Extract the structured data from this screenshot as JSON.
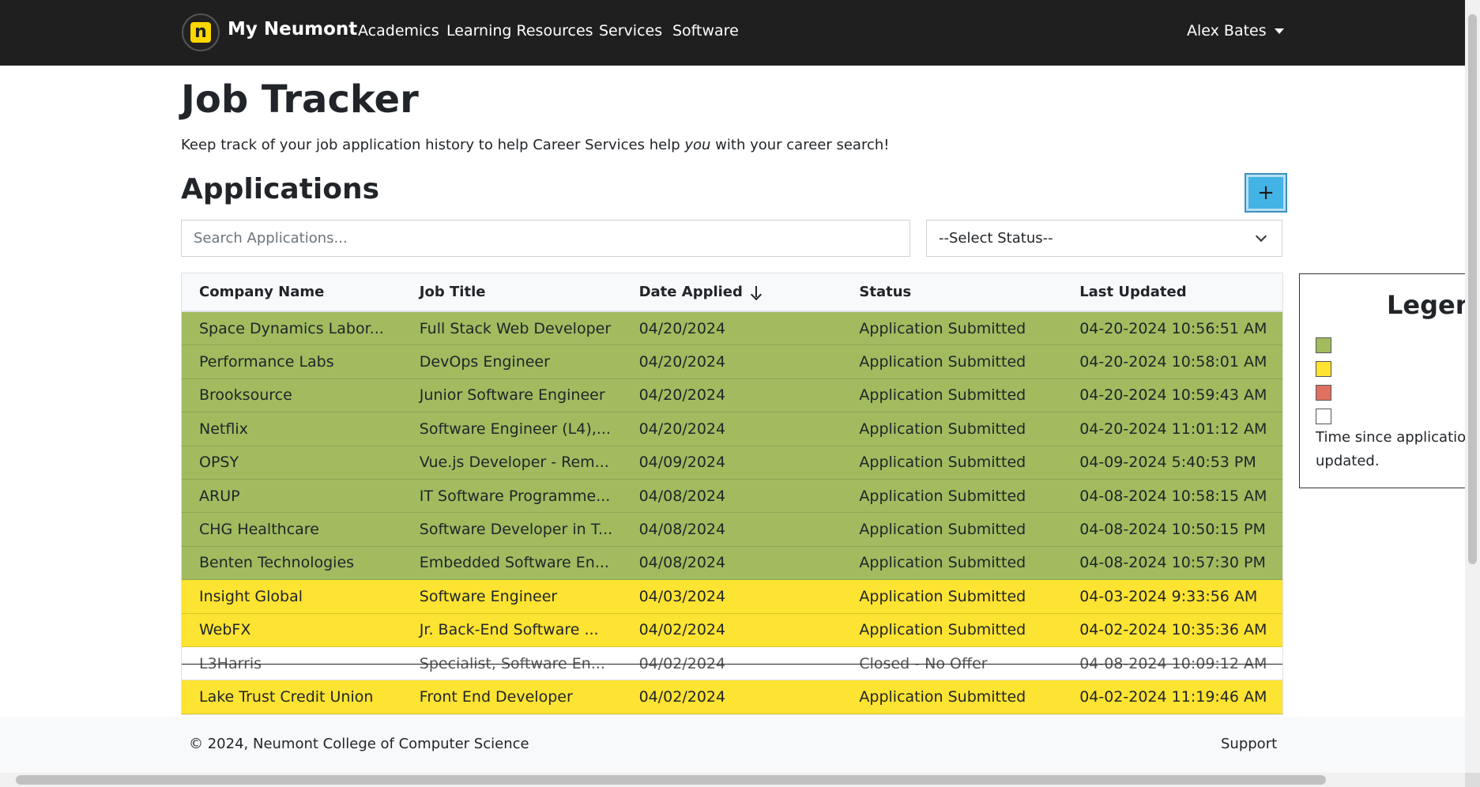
{
  "navbar": {
    "logo_letter": "n",
    "brand": "My Neumont",
    "links": [
      "Academics",
      "Learning Resources",
      "Services",
      "Software"
    ],
    "user": "Alex Bates"
  },
  "page": {
    "title": "Job Tracker",
    "intro_before": "Keep track of your job application history to help Career Services help ",
    "intro_em": "you",
    "intro_after": " with your career search!",
    "section_title": "Applications",
    "add_label": "+"
  },
  "filters": {
    "search_placeholder": "Search Applications...",
    "status_selected": "--Select Status--"
  },
  "table": {
    "headers": [
      "Company Name",
      "Job Title",
      "Date Applied",
      "Status",
      "Last Updated"
    ],
    "sorted_column": "Date Applied",
    "sort_direction": "descending",
    "rows": [
      {
        "company": "Space Dynamics Labor...",
        "title": "Full Stack Web Developer",
        "date": "04/20/2024",
        "status": "Application Submitted",
        "updated": "04-20-2024 10:56:51 AM",
        "color": "green"
      },
      {
        "company": "Performance Labs",
        "title": "DevOps Engineer",
        "date": "04/20/2024",
        "status": "Application Submitted",
        "updated": "04-20-2024 10:58:01 AM",
        "color": "green"
      },
      {
        "company": "Brooksource",
        "title": "Junior Software Engineer",
        "date": "04/20/2024",
        "status": "Application Submitted",
        "updated": "04-20-2024 10:59:43 AM",
        "color": "green"
      },
      {
        "company": "Netflix",
        "title": "Software Engineer (L4),...",
        "date": "04/20/2024",
        "status": "Application Submitted",
        "updated": "04-20-2024 11:01:12 AM",
        "color": "green"
      },
      {
        "company": "OPSY",
        "title": "Vue.js Developer - Rem...",
        "date": "04/09/2024",
        "status": "Application Submitted",
        "updated": "04-09-2024 5:40:53 PM",
        "color": "green"
      },
      {
        "company": "ARUP",
        "title": "IT Software Programme...",
        "date": "04/08/2024",
        "status": "Application Submitted",
        "updated": "04-08-2024 10:58:15 AM",
        "color": "green"
      },
      {
        "company": "CHG Healthcare",
        "title": "Software Developer in T...",
        "date": "04/08/2024",
        "status": "Application Submitted",
        "updated": "04-08-2024 10:50:15 PM",
        "color": "green"
      },
      {
        "company": "Benten Technologies",
        "title": "Embedded Software En...",
        "date": "04/08/2024",
        "status": "Application Submitted",
        "updated": "04-08-2024 10:57:30 PM",
        "color": "green"
      },
      {
        "company": "Insight Global",
        "title": "Software Engineer",
        "date": "04/03/2024",
        "status": "Application Submitted",
        "updated": "04-03-2024 9:33:56 AM",
        "color": "yellow"
      },
      {
        "company": "WebFX",
        "title": "Jr. Back-End Software ...",
        "date": "04/02/2024",
        "status": "Application Submitted",
        "updated": "04-02-2024 10:35:36 AM",
        "color": "yellow"
      },
      {
        "company": "L3Harris",
        "title": "Specialist, Software En...",
        "date": "04/02/2024",
        "status": "Closed - No Offer",
        "updated": "04-08-2024 10:09:12 AM",
        "color": "white",
        "closed": true
      },
      {
        "company": "Lake Trust Credit Union",
        "title": "Front End Developer",
        "date": "04/02/2024",
        "status": "Application Submitted",
        "updated": "04-02-2024 11:19:46 AM",
        "color": "yellow"
      }
    ]
  },
  "legend": {
    "title": "Legend",
    "swatches": [
      "#a2bb5f",
      "#fde332",
      "#e07060",
      "#ffffff"
    ],
    "note": "Time since application updated."
  },
  "footer": {
    "copyright": "© 2024, Neumont College of Computer Science",
    "support": "Support"
  },
  "colors": {
    "navbar": "#1f1f1f",
    "row_green": "#a2bb5f",
    "row_yellow": "#fde332",
    "row_red": "#e07060",
    "add_button": "#43b3e6",
    "logo": "#ffd600"
  }
}
